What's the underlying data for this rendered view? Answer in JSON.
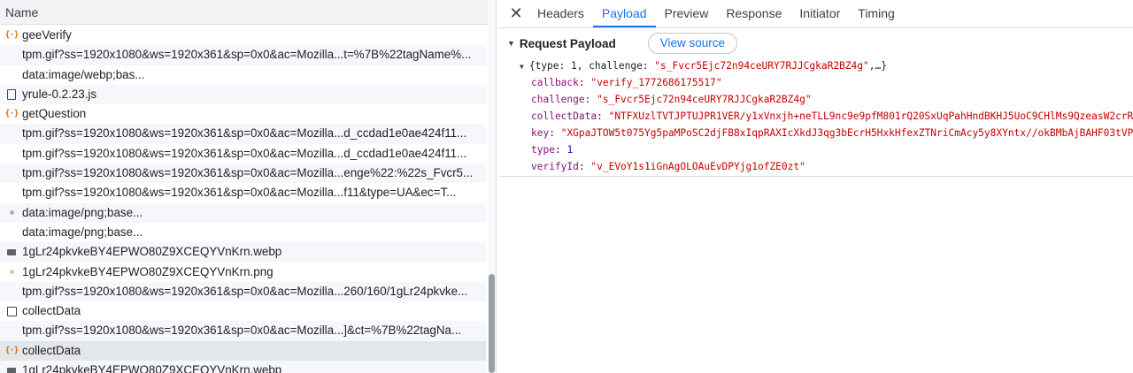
{
  "list": {
    "header": "Name",
    "rows": [
      {
        "name": "geeVerify",
        "icon": "xhr-icon",
        "child": false,
        "selected": false
      },
      {
        "name": "tpm.gif?ss=1920x1080&ws=1920x361&sp=0x0&ac=Mozilla...t=%7B%22tagName%...",
        "icon": "none",
        "child": true,
        "selected": false
      },
      {
        "name": "data:image/webp;bas...",
        "icon": "none",
        "child": true,
        "selected": false
      },
      {
        "name": "yrule-0.2.23.js",
        "icon": "document-icon",
        "child": false,
        "selected": false
      },
      {
        "name": "getQuestion",
        "icon": "xhr-icon",
        "child": false,
        "selected": false
      },
      {
        "name": "tpm.gif?ss=1920x1080&ws=1920x361&sp=0x0&ac=Mozilla...d_ccdad1e0ae424f11...",
        "icon": "none",
        "child": true,
        "selected": false
      },
      {
        "name": "tpm.gif?ss=1920x1080&ws=1920x361&sp=0x0&ac=Mozilla...d_ccdad1e0ae424f11...",
        "icon": "none",
        "child": true,
        "selected": false
      },
      {
        "name": "tpm.gif?ss=1920x1080&ws=1920x361&sp=0x0&ac=Mozilla...enge%22:%22s_Fvcr5...",
        "icon": "none",
        "child": true,
        "selected": false
      },
      {
        "name": "tpm.gif?ss=1920x1080&ws=1920x361&sp=0x0&ac=Mozilla...f11&type=UA&ec=T...",
        "icon": "none",
        "child": true,
        "selected": false
      },
      {
        "name": "data:image/png;base...",
        "icon": "gray-dot-icon",
        "child": false,
        "selected": false
      },
      {
        "name": "data:image/png;base...",
        "icon": "none",
        "child": true,
        "selected": false
      },
      {
        "name": "1gLr24pkvkeBY4EPWO80Z9XCEQYVnKrn.webp",
        "icon": "image-icon",
        "child": false,
        "selected": false
      },
      {
        "name": "1gLr24pkvkeBY4EPWO80Z9XCEQYVnKrn.png",
        "icon": "tan-dot-icon",
        "child": false,
        "selected": false
      },
      {
        "name": "tpm.gif?ss=1920x1080&ws=1920x361&sp=0x0&ac=Mozilla...260/160/1gLr24pkvke...",
        "icon": "none",
        "child": true,
        "selected": false
      },
      {
        "name": "collectData",
        "icon": "checkbox-icon",
        "child": false,
        "selected": false
      },
      {
        "name": "tpm.gif?ss=1920x1080&ws=1920x361&sp=0x0&ac=Mozilla...]&ct=%7B%22tagNa...",
        "icon": "none",
        "child": true,
        "selected": false
      },
      {
        "name": "collectData",
        "icon": "xhr-icon",
        "child": false,
        "selected": true
      },
      {
        "name": "1gLr24pkvkeBY4EPWO80Z9XCEQYVnKrn.webp",
        "icon": "image-icon",
        "child": false,
        "selected": false
      }
    ]
  },
  "detail": {
    "close_glyph": "✕",
    "tabs": [
      {
        "label": "Headers",
        "active": false
      },
      {
        "label": "Payload",
        "active": true
      },
      {
        "label": "Preview",
        "active": false
      },
      {
        "label": "Response",
        "active": false
      },
      {
        "label": "Initiator",
        "active": false
      },
      {
        "label": "Timing",
        "active": false
      }
    ],
    "section_title": "Request Payload",
    "view_source_label": "View source",
    "summary": {
      "open": "{type: 1, challenge: ",
      "challenge": "\"s_Fvcr5Ejc72n94ceURY7RJJCgkaR2BZ4g\"",
      "close": ",…}"
    },
    "fields": [
      {
        "key": "callback",
        "value": "\"verify_1772686175517\"",
        "kind": "string"
      },
      {
        "key": "challenge",
        "value": "\"s_Fvcr5Ejc72n94ceURY7RJJCgkaR2BZ4g\"",
        "kind": "string"
      },
      {
        "key": "collectData",
        "value": "\"NTFXUzlTVTJPTUJPR1VER/y1xVnxjh+neTLL9nc9e9pfM801rQ20SxUqPahHndBKHJ5UoC9CHlMs9QzeasW2crR",
        "kind": "string"
      },
      {
        "key": "key",
        "value": "\"XGpaJTOW5t075Yg5paMPoSC2djFB8xIqpRAXIcXkdJ3qg3bEcrH5HxkHfexZTNriCmAcy5y8XYntx//okBMbAjBAHF03tVP",
        "kind": "string"
      },
      {
        "key": "type",
        "value": "1",
        "kind": "number"
      },
      {
        "key": "verifyId",
        "value": "\"v_EVoY1s1iGnAgOLOAuEvDPYjg1ofZE0zt\"",
        "kind": "string"
      }
    ]
  },
  "colors": {
    "accent": "#1a73e8",
    "key": "#881280",
    "string": "#c80000",
    "number": "#1a1aa6",
    "xhr_icon": "#e8710a"
  }
}
